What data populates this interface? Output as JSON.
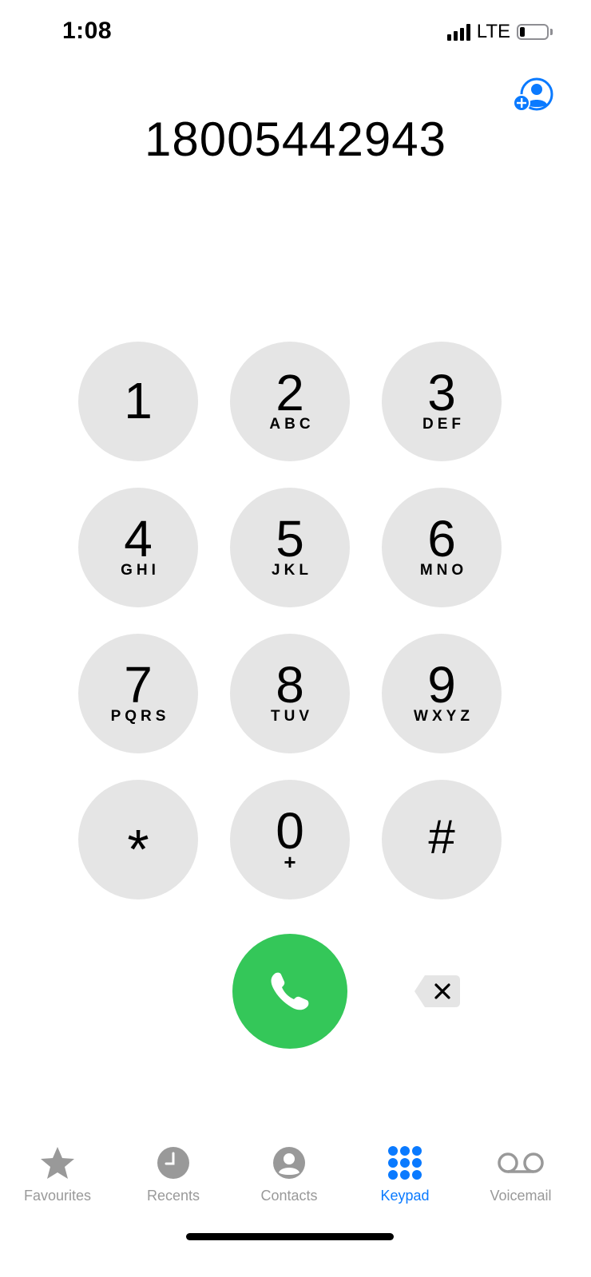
{
  "status_bar": {
    "time": "1:08",
    "network": "LTE",
    "battery_level": 0.2
  },
  "dialer": {
    "number": "18005442943",
    "add_contact_icon": "person-add-icon"
  },
  "keypad": {
    "keys": [
      {
        "digit": "1",
        "letters": ""
      },
      {
        "digit": "2",
        "letters": "ABC"
      },
      {
        "digit": "3",
        "letters": "DEF"
      },
      {
        "digit": "4",
        "letters": "GHI"
      },
      {
        "digit": "5",
        "letters": "JKL"
      },
      {
        "digit": "6",
        "letters": "MNO"
      },
      {
        "digit": "7",
        "letters": "PQRS"
      },
      {
        "digit": "8",
        "letters": "TUV"
      },
      {
        "digit": "9",
        "letters": "WXYZ"
      },
      {
        "digit": "*",
        "letters": ""
      },
      {
        "digit": "0",
        "letters": "+"
      },
      {
        "digit": "#",
        "letters": ""
      }
    ]
  },
  "actions": {
    "call_icon": "phone-icon",
    "delete_icon": "backspace-icon"
  },
  "tab_bar": {
    "tabs": [
      {
        "label": "Favourites",
        "icon": "star-icon",
        "active": false
      },
      {
        "label": "Recents",
        "icon": "clock-icon",
        "active": false
      },
      {
        "label": "Contacts",
        "icon": "person-circle-icon",
        "active": false
      },
      {
        "label": "Keypad",
        "icon": "keypad-grid-icon",
        "active": true
      },
      {
        "label": "Voicemail",
        "icon": "voicemail-icon",
        "active": false
      }
    ]
  },
  "colors": {
    "accent": "#0a7aff",
    "call_green": "#34c759",
    "key_background": "#e5e5e5",
    "inactive_tab": "#999999"
  }
}
